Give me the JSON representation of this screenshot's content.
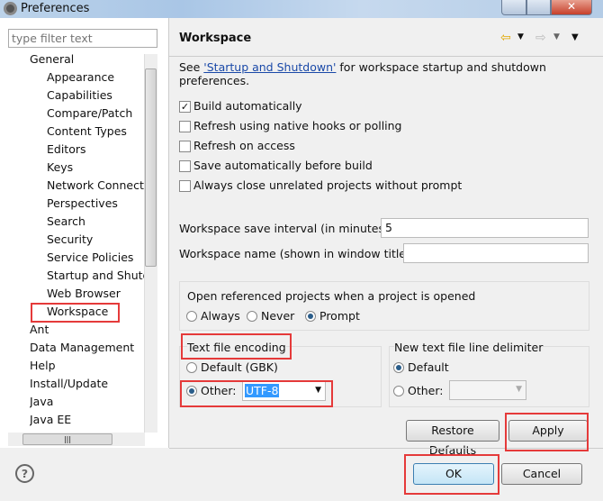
{
  "window": {
    "title": "Preferences"
  },
  "filter": {
    "placeholder": "type filter text"
  },
  "tree": [
    {
      "label": "General",
      "level": 0
    },
    {
      "label": "Appearance",
      "level": 1
    },
    {
      "label": "Capabilities",
      "level": 1
    },
    {
      "label": "Compare/Patch",
      "level": 1
    },
    {
      "label": "Content Types",
      "level": 1
    },
    {
      "label": "Editors",
      "level": 1
    },
    {
      "label": "Keys",
      "level": 1
    },
    {
      "label": "Network Connections",
      "level": 1
    },
    {
      "label": "Perspectives",
      "level": 1
    },
    {
      "label": "Search",
      "level": 1
    },
    {
      "label": "Security",
      "level": 1
    },
    {
      "label": "Service Policies",
      "level": 1
    },
    {
      "label": "Startup and Shutdown",
      "level": 1
    },
    {
      "label": "Web Browser",
      "level": 1
    },
    {
      "label": "Workspace",
      "level": 1,
      "selected": true
    },
    {
      "label": "Ant",
      "level": 0
    },
    {
      "label": "Data Management",
      "level": 0
    },
    {
      "label": "Help",
      "level": 0
    },
    {
      "label": "Install/Update",
      "level": 0
    },
    {
      "label": "Java",
      "level": 0
    },
    {
      "label": "Java EE",
      "level": 0
    }
  ],
  "page": {
    "title": "Workspace",
    "see_prefix": "See ",
    "see_link": "'Startup and Shutdown'",
    "see_suffix": " for workspace startup and shutdown preferences.",
    "checkboxes": [
      {
        "label": "Build automatically",
        "checked": true
      },
      {
        "label": "Refresh using native hooks or polling",
        "checked": false
      },
      {
        "label": "Refresh on access",
        "checked": false
      },
      {
        "label": "Save automatically before build",
        "checked": false
      },
      {
        "label": "Always close unrelated projects without prompt",
        "checked": false
      }
    ],
    "save_interval_label": "Workspace save interval (in minutes):",
    "save_interval_value": "5",
    "name_label": "Workspace name (shown in window title):",
    "name_value": "",
    "open_ref_label": "Open referenced projects when a project is opened",
    "open_ref_options": [
      "Always",
      "Never",
      "Prompt"
    ],
    "open_ref_selected": "Prompt",
    "encoding": {
      "label": "Text file encoding",
      "default": "Default (GBK)",
      "other": "Other:",
      "value": "UTF-8",
      "selected": "Other"
    },
    "delimiter": {
      "label": "New text file line delimiter",
      "default": "Default",
      "other": "Other:",
      "value": "",
      "selected": "Default"
    },
    "restore_defaults": "Restore Defaults",
    "apply": "Apply"
  },
  "footer": {
    "ok": "OK",
    "cancel": "Cancel",
    "help_icon": "?"
  },
  "highlight_color": "#e53a3a",
  "selection_color": "#3399ff"
}
